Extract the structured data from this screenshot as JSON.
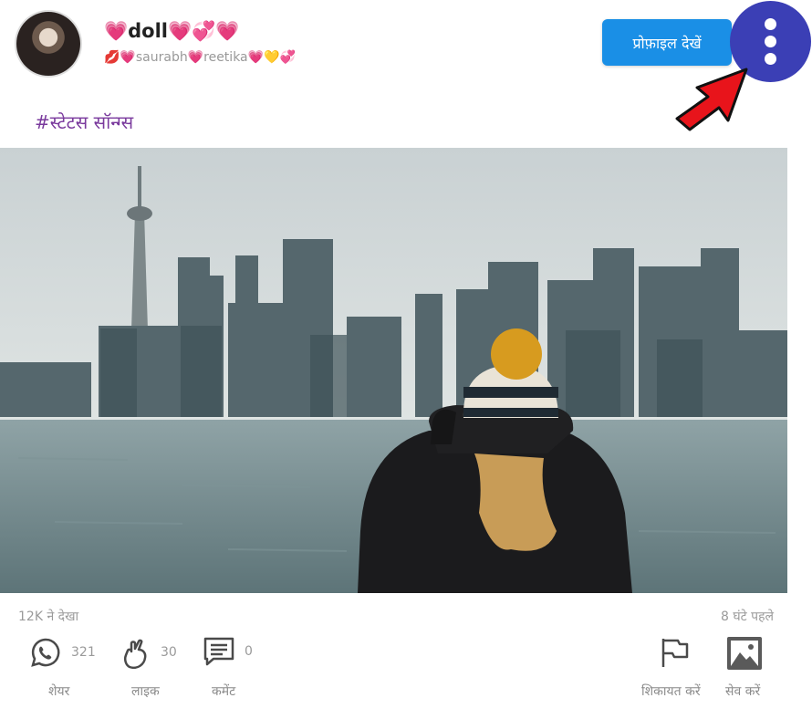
{
  "header": {
    "username": "💗doll💗💞💗",
    "subtitle": "💋💗saurabh💗reetika💗💛💞",
    "profile_button": "प्रोफ़ाइल देखें"
  },
  "post": {
    "hashtag": "#स्टेटस सॉन्ग्स",
    "views": "12K ने देखा",
    "time_ago": "8 घंटे पहले"
  },
  "actions": {
    "share": {
      "count": "321",
      "label": "शेयर"
    },
    "like": {
      "count": "30",
      "label": "लाइक"
    },
    "comment": {
      "count": "0",
      "label": "कमेंट"
    },
    "report": {
      "label": "शिकायत करें"
    },
    "save": {
      "label": "सेव करें"
    }
  },
  "colors": {
    "profile_button": "#1a8fe6",
    "menu_button": "#3b3fb5",
    "arrow": "#e8141b",
    "hashtag": "#7a3a9d"
  },
  "icons": [
    "whatsapp-icon",
    "like-hand-icon",
    "comment-icon",
    "flag-icon",
    "image-icon",
    "more-vertical-icon"
  ]
}
